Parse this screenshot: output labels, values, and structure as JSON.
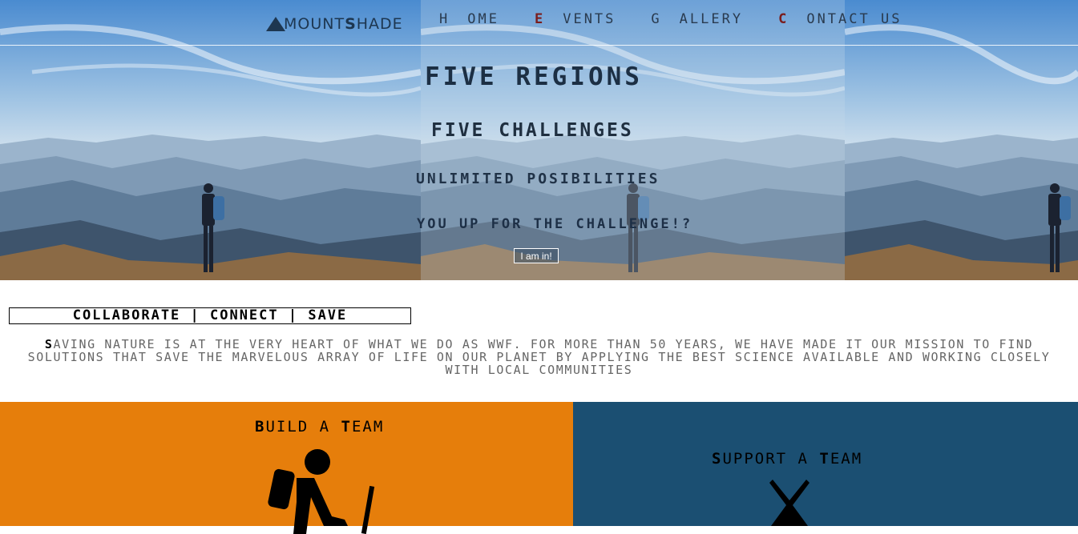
{
  "brand": {
    "first_letter": "A",
    "rest1": "MOUNT ",
    "bold": "S",
    "rest2": "HADE",
    "logo_icon": "triangle-icon"
  },
  "nav": {
    "items": [
      {
        "first": "H",
        "rest": "OME",
        "accent": false
      },
      {
        "first": "E",
        "rest": "VENTS",
        "accent": true
      },
      {
        "first": "G",
        "rest": "ALLERY",
        "accent": false
      },
      {
        "first": "C",
        "rest": "ONTACT US",
        "accent": true
      }
    ],
    "accent_color": "#7a1d1d"
  },
  "hero": {
    "headline": "FIVE REGIONS",
    "subhead": "FIVE CHALLENGES",
    "line3": "UNLIMITED POSIBILITIES",
    "line4": "YOU UP FOR THE CHALLENGE!?",
    "cta_label": "I am in!"
  },
  "tagline": "COLLABORATE | CONNECT | SAVE",
  "mission": {
    "first": "S",
    "text": "AVING NATURE IS AT THE VERY HEART OF WHAT WE DO AS WWF. FOR MORE THAN 50 YEARS, WE HAVE MADE IT OUR MISSION TO FIND SOLUTIONS THAT SAVE THE MARVELOUS ARRAY OF LIFE ON OUR PLANET BY APPLYING THE BEST SCIENCE AVAILABLE AND WORKING CLOSELY WITH LOCAL COMMUNITIES"
  },
  "cards": {
    "build": {
      "first": "B",
      "rest": "UILD A ",
      "bold2": "T",
      "rest2": "EAM",
      "color": "#e67e0b",
      "icon": "hiker-icon"
    },
    "support": {
      "first": "S",
      "rest": "UPPORT A ",
      "bold2": "T",
      "rest2": "EAM",
      "color": "#1b4f72",
      "icon": "tent-icon"
    }
  }
}
